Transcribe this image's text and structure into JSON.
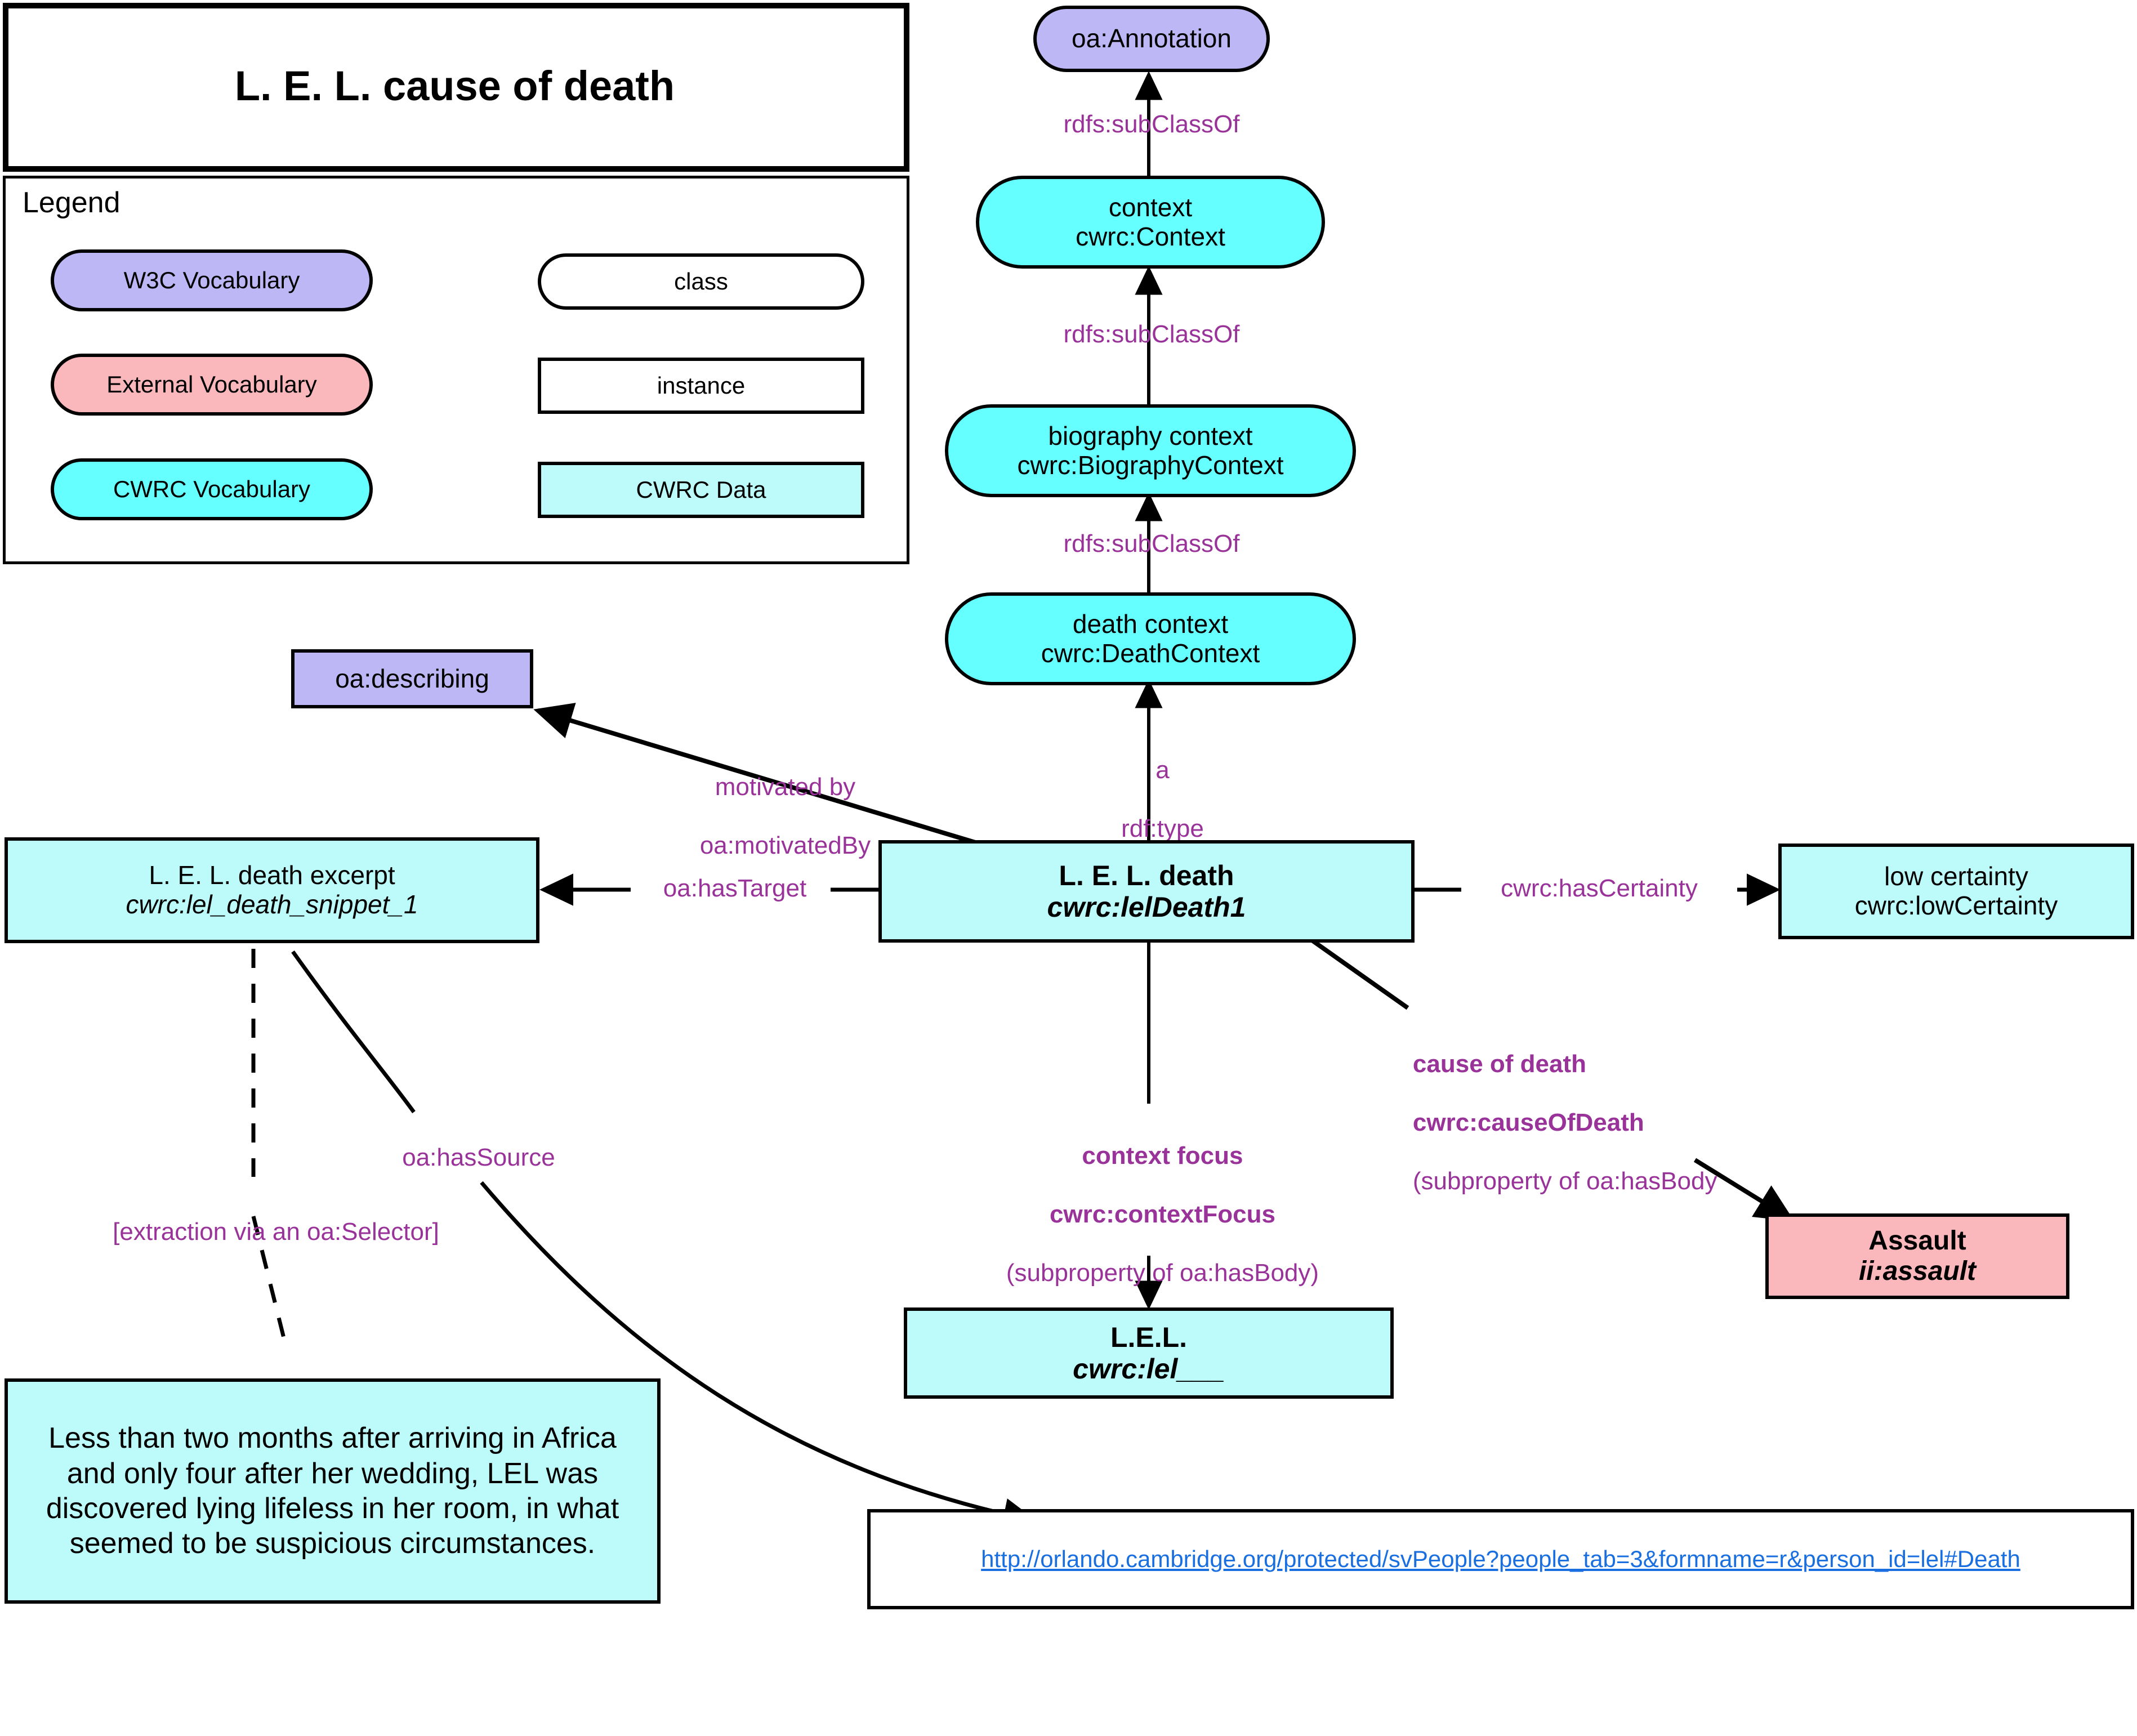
{
  "title": {
    "text": "L. E. L. cause of death"
  },
  "legend": {
    "heading": "Legend",
    "items": [
      {
        "label": "W3C Vocabulary",
        "shape": "rounded",
        "color": "#bdb8f5"
      },
      {
        "label": "External Vocabulary",
        "shape": "rounded",
        "color": "#fab8bc"
      },
      {
        "label": "CWRC Vocabulary",
        "shape": "rounded",
        "color": "#66ffff"
      },
      {
        "label": "class",
        "shape": "rounded",
        "color": "#ffffff"
      },
      {
        "label": "instance",
        "shape": "rect",
        "color": "#ffffff"
      },
      {
        "label": "CWRC Data",
        "shape": "rect",
        "color": "#bdfafa"
      }
    ]
  },
  "colors": {
    "w3c_vocabulary": "#bdb8f5",
    "external_vocabulary": "#fab8bc",
    "cwrc_vocabulary": "#66ffff",
    "cwrc_data": "#bdfafa",
    "predicate_text": "#993399",
    "link_text": "#1a6fe0",
    "outline": "#000000"
  },
  "nodes": {
    "oa_annotation": {
      "line1": "oa:Annotation"
    },
    "context": {
      "line1": "context",
      "line2": "cwrc:Context"
    },
    "biography_context": {
      "line1": "biography context",
      "line2": "cwrc:BiographyContext"
    },
    "death_context": {
      "line1": "death context",
      "line2": "cwrc:DeathContext"
    },
    "oa_describing": {
      "line1": "oa:describing"
    },
    "lel_death_excerpt": {
      "line1": "L. E. L. death excerpt",
      "line2": "cwrc:lel_death_snippet_1"
    },
    "lel_death": {
      "line1": "L. E. L. death",
      "line2": "cwrc:lelDeath1"
    },
    "low_certainty": {
      "line1": "low certainty",
      "line2": "cwrc:lowCertainty"
    },
    "assault": {
      "line1": "Assault",
      "line2": "ii:assault"
    },
    "lel": {
      "line1": "L.E.L.",
      "line2": "cwrc:lel___"
    },
    "excerpt_quote": {
      "text": "Less than two months after arriving in Africa and only four after her wedding, LEL was discovered lying lifeless in her room, in what seemed to be suspicious circumstances."
    },
    "source_url": {
      "url": "http://orlando.cambridge.org/protected/svPeople?people_tab=3&formname=r&person_id=lel#Death"
    }
  },
  "edges": {
    "subclassof_1": {
      "label": "rdfs:subClassOf"
    },
    "subclassof_2": {
      "label": "rdfs:subClassOf"
    },
    "subclassof_3": {
      "label": "rdfs:subClassOf"
    },
    "rdf_type": {
      "line1": "a",
      "line2": "rdf:type"
    },
    "motivated_by": {
      "line1": "motivated by",
      "line2": "oa:motivatedBy"
    },
    "has_target": {
      "label": "oa:hasTarget"
    },
    "has_certainty": {
      "label": "cwrc:hasCertainty"
    },
    "cause_of_death": {
      "line1": "cause of death",
      "line2": "cwrc:causeOfDeath",
      "line3": "(subproperty of oa:hasBody"
    },
    "context_focus": {
      "line1": "context focus",
      "line2": "cwrc:contextFocus",
      "line3": "(subproperty of oa:hasBody)"
    },
    "has_source": {
      "label": "oa:hasSource"
    },
    "selector_note": {
      "label": "[extraction via an oa:Selector]"
    }
  }
}
